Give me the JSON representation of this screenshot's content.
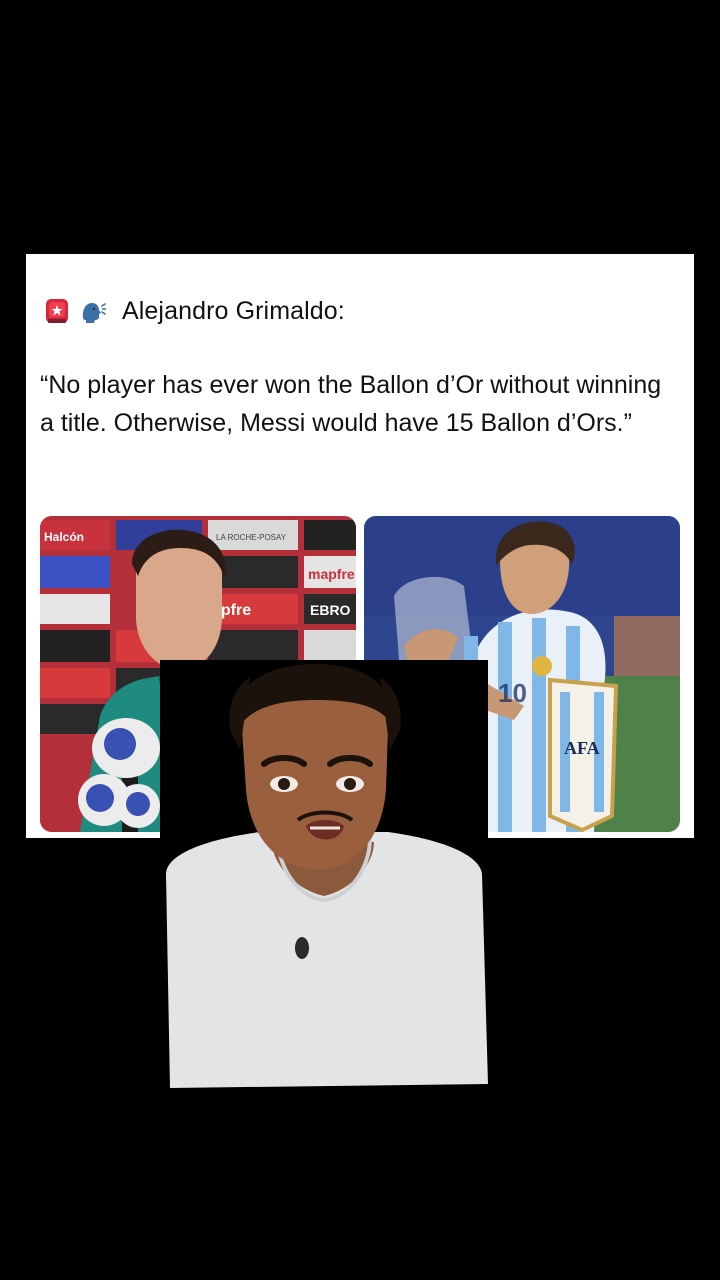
{
  "post": {
    "author": "Alejandro Grimaldo:",
    "quote": "“No player has ever won the Ballon d’Or without winning a title. Otherwise, Messi would have 15 Ballon d’Ors.”",
    "header_icons": [
      "siren-icon",
      "speaking-head-icon"
    ],
    "colors": {
      "card_background": "#ffffff",
      "page_background": "#000000",
      "text": "#111111"
    }
  },
  "images": {
    "left_photo": {
      "sponsor_board": [
        "Halcón",
        "LA ROCHE-POSAY",
        "mapfre",
        "EBRO",
        "apfre"
      ]
    },
    "right_photo": {
      "jersey_text": [
        "AFA",
        "10"
      ]
    }
  }
}
